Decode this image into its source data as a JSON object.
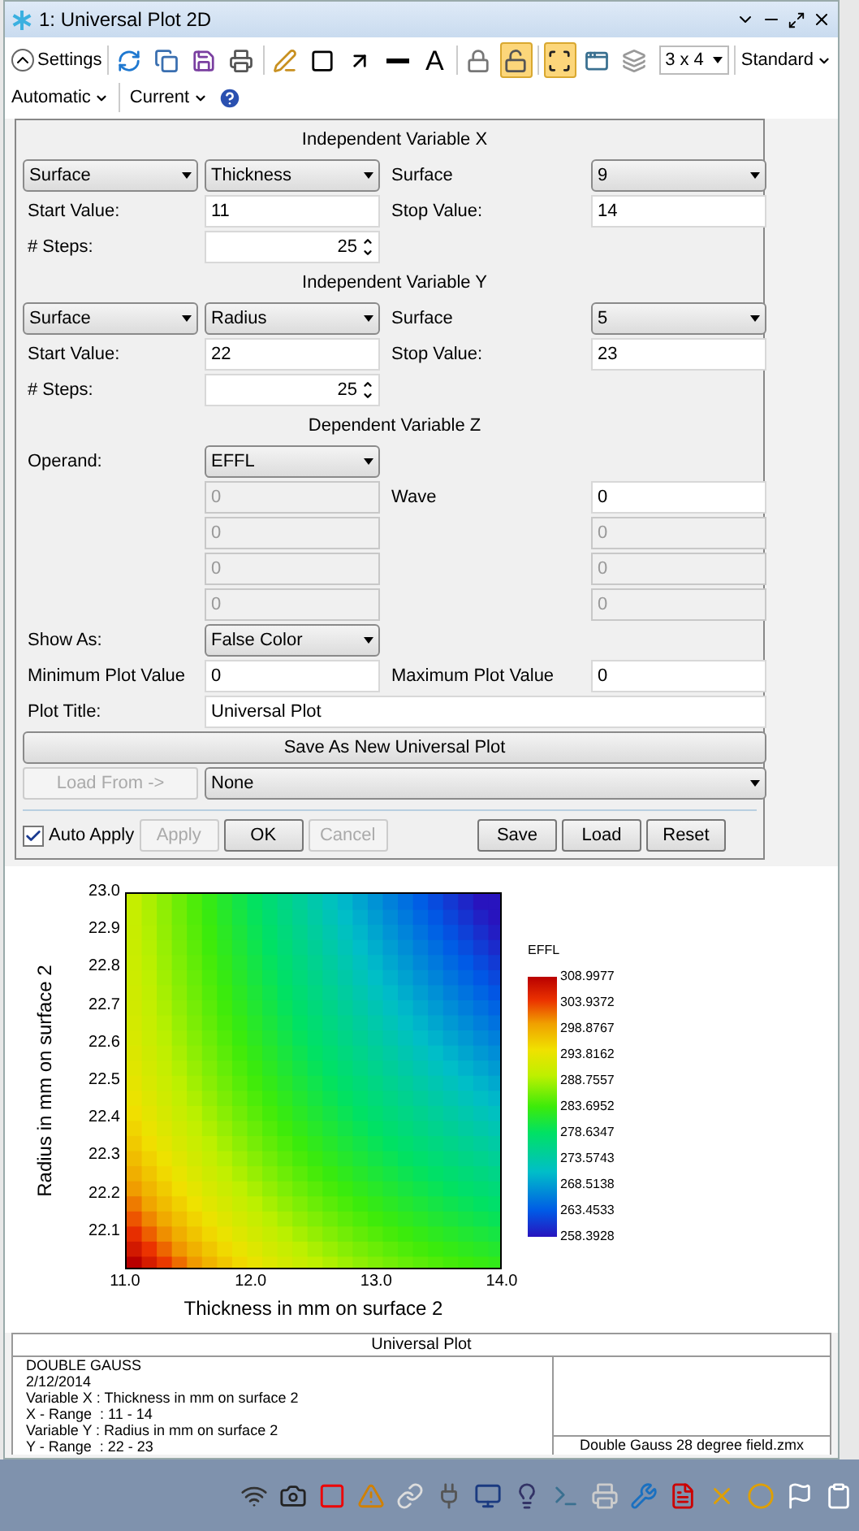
{
  "window": {
    "title": "1: Universal Plot 2D"
  },
  "toolbar": {
    "settings": "Settings",
    "tools": [
      {
        "kind": "refresh",
        "active": false
      },
      {
        "kind": "copy",
        "active": false
      },
      {
        "kind": "save",
        "active": false
      },
      {
        "kind": "print",
        "active": false
      },
      {
        "kind": "pencil",
        "active": false
      },
      {
        "kind": "rectangle",
        "active": false
      },
      {
        "kind": "arrow",
        "active": false
      },
      {
        "kind": "line",
        "active": false
      },
      {
        "kind": "text",
        "label": "A",
        "active": false
      },
      {
        "kind": "lock",
        "active": false
      },
      {
        "kind": "unlock",
        "active": true
      },
      {
        "kind": "fit",
        "active": true
      },
      {
        "kind": "window",
        "active": false
      },
      {
        "kind": "layers",
        "active": false
      }
    ],
    "layout": "3 x 4",
    "standard": "Standard",
    "automatic": "Automatic",
    "current": "Current"
  },
  "form": {
    "x_var": {
      "heading": "Independent Variable X",
      "type": "Surface",
      "param": "Thickness",
      "surface_label": "Surface",
      "surface": "9",
      "start_label": "Start Value:",
      "start": "11",
      "stop_label": "Stop Value:",
      "stop": "14",
      "steps_label": "# Steps:",
      "steps": "25"
    },
    "y_var": {
      "heading": "Independent Variable Y",
      "type": "Surface",
      "param": "Radius",
      "surface_label": "Surface",
      "surface": "5",
      "start_label": "Start Value:",
      "start": "22",
      "stop_label": "Stop Value:",
      "stop": "23",
      "steps_label": "# Steps:",
      "steps": "25"
    },
    "z_var": {
      "heading": "Dependent Variable Z",
      "operand_label": "Operand:",
      "operand": "EFFL",
      "wave_label": "Wave",
      "params_left": [
        {
          "value": "0",
          "disabled": true
        },
        {
          "value": "0",
          "disabled": true
        },
        {
          "value": "0",
          "disabled": true
        },
        {
          "value": "0",
          "disabled": true
        }
      ],
      "params_right": [
        {
          "value": "0",
          "disabled": false
        },
        {
          "value": "0",
          "disabled": true
        },
        {
          "value": "0",
          "disabled": true
        },
        {
          "value": "0",
          "disabled": true
        }
      ]
    },
    "show_as_label": "Show As:",
    "show_as": "False Color",
    "min_label": "Minimum Plot Value",
    "min": "0",
    "max_label": "Maximum Plot Value",
    "max": "0",
    "title_label": "Plot Title:",
    "title": "Universal Plot",
    "save_new": "Save As New Universal Plot",
    "load_from": {
      "label": "Load From ->",
      "disabled": true
    },
    "load_select": "None",
    "auto_apply": {
      "label": "Auto Apply",
      "checked": true
    },
    "buttons_left": [
      {
        "label": "Apply",
        "disabled": true
      },
      {
        "label": "OK",
        "disabled": false
      },
      {
        "label": "Cancel",
        "disabled": true
      }
    ],
    "buttons_right": [
      {
        "label": "Save",
        "disabled": false
      },
      {
        "label": "Load",
        "disabled": false
      },
      {
        "label": "Reset",
        "disabled": false
      }
    ]
  },
  "plot": {
    "ylabel": "Radius in mm on surface 2",
    "xlabel": "Thickness in mm on surface 2",
    "xticks": [
      "11.0",
      "12.0",
      "13.0",
      "14.0"
    ],
    "yticks": [
      "23.0",
      "22.9",
      "22.8",
      "22.7",
      "22.6",
      "22.5",
      "22.4",
      "22.3",
      "22.2",
      "22.1"
    ],
    "legend_title": "EFFL",
    "legend_ticks": [
      "308.9977",
      "303.9372",
      "298.8767",
      "293.8162",
      "288.7557",
      "283.6952",
      "278.6347",
      "273.5743",
      "268.5138",
      "263.4533",
      "258.3928"
    ]
  },
  "info": {
    "title": "Universal Plot",
    "lines": [
      "DOUBLE GAUSS",
      "2/12/2014",
      "Variable X : Thickness in mm on surface 2",
      "X - Range  : 11 - 14",
      "Variable Y : Radius in mm on surface 2",
      "Y - Range  : 22 - 23"
    ],
    "file": "Double Gauss 28 degree field.zmx"
  }
}
